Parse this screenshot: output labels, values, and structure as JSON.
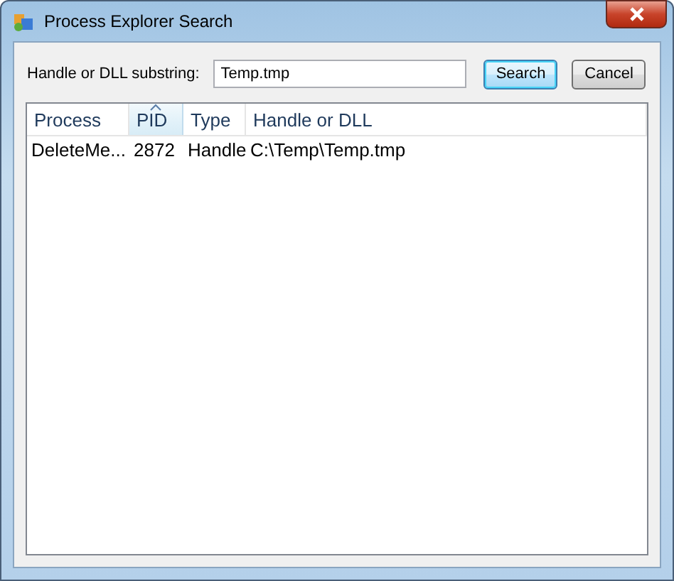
{
  "window": {
    "title": "Process Explorer Search"
  },
  "search": {
    "label": "Handle or DLL substring:",
    "value": "Temp.tmp"
  },
  "buttons": [
    {
      "label": "Search",
      "default": true
    },
    {
      "label": "Cancel",
      "default": false
    }
  ],
  "table": {
    "columns": [
      {
        "label": "Process",
        "sorted": false
      },
      {
        "label": "PID",
        "sorted": true
      },
      {
        "label": "Type",
        "sorted": false
      },
      {
        "label": "Handle or DLL",
        "sorted": false
      }
    ],
    "rows": [
      [
        "DeleteMe...",
        "2872",
        "Handle",
        "C:\\Temp\\Temp.tmp"
      ]
    ]
  }
}
